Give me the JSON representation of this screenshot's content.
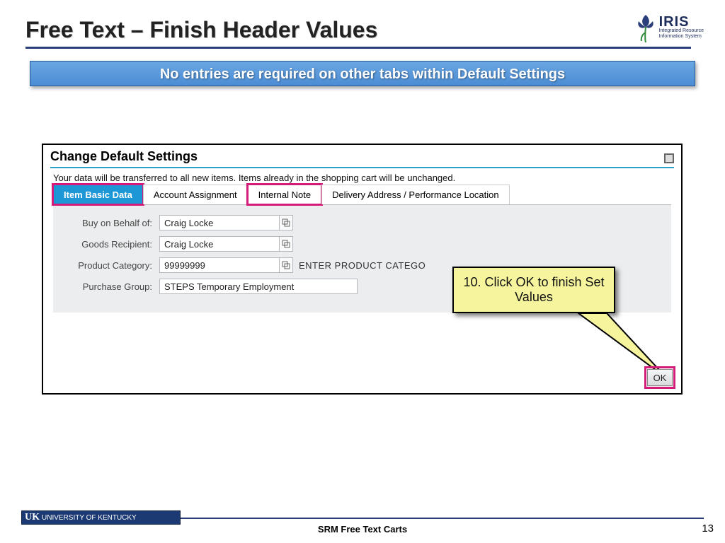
{
  "slide": {
    "title": "Free Text – Finish Header Values",
    "banner": "No entries are required on other tabs within Default Settings",
    "footer_center": "SRM Free Text Carts",
    "page": "13",
    "uk_label": "UNIVERSITY OF KENTUCKY",
    "uk_short": "UK"
  },
  "iris": {
    "name": "IRIS",
    "sub1": "Integrated Resource",
    "sub2": "Information System"
  },
  "dialog": {
    "title": "Change Default Settings",
    "note": "Your data will be transferred to all new items. Items already in the shopping cart will be unchanged.",
    "tabs": [
      "Item Basic Data",
      "Account Assignment",
      "Internal Note",
      "Delivery Address / Performance Location"
    ],
    "fields": {
      "buy_label": "Buy on Behalf of:",
      "buy_value": "Craig Locke",
      "recip_label": "Goods Recipient:",
      "recip_value": "Craig Locke",
      "prodcat_label": "Product Category:",
      "prodcat_value": "99999999",
      "prodcat_hint": "ENTER PRODUCT CATEGO",
      "pgroup_label": "Purchase Group:",
      "pgroup_value": "STEPS Temporary Employment"
    },
    "ok": "OK"
  },
  "callout": {
    "text": "10. Click OK to finish Set Values"
  }
}
